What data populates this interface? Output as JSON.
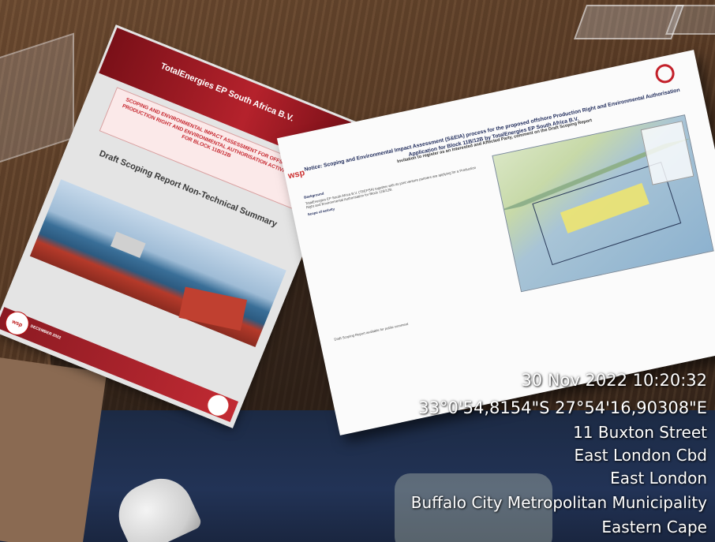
{
  "booklet": {
    "company": "TotalEnergies EP South Africa B.V.",
    "title": "Scoping and Environmental Impact Assessment for Offshore Production Right and Environmental Authorisation Activities for Block 11B/12B",
    "subtitle": "Draft Scoping Report Non-Technical Summary",
    "logo_text": "wsp",
    "date": "DECEMBER 2022"
  },
  "poster": {
    "logo_text": "wsp",
    "title": "Notice: Scoping and Environmental Impact Assessment (S&EIA) process for the proposed offshore Production Right and Environmental Authorisation Application for Block 11B/12B by TotalEnergies EP South Africa B.V.",
    "subtitle": "Invitation to register as an Interested and Affected Party, comment on the Draft Scoping Report",
    "body_heading": "Background",
    "body_text": "TotalEnergies EP South Africa B.V. (TEEPSA) together with its joint venture partners are applying for a Production Right and Environmental Authorisation for Block 11B/12B.",
    "activities_heading": "Scope of activity",
    "lower_heading": "Draft Scoping Report available for public comment"
  },
  "overlay": {
    "datetime": "30 Nov 2022 10:20:32",
    "coordinates": "33°0'54,8154\"S 27°54'16,90308\"E",
    "street": "11 Buxton Street",
    "suburb": "East London Cbd",
    "city": "East London",
    "municipality": "Buffalo City Metropolitan Municipality",
    "province": "Eastern Cape"
  },
  "colors": {
    "brand_red": "#c3202a",
    "overlay_text": "#ffffff"
  }
}
